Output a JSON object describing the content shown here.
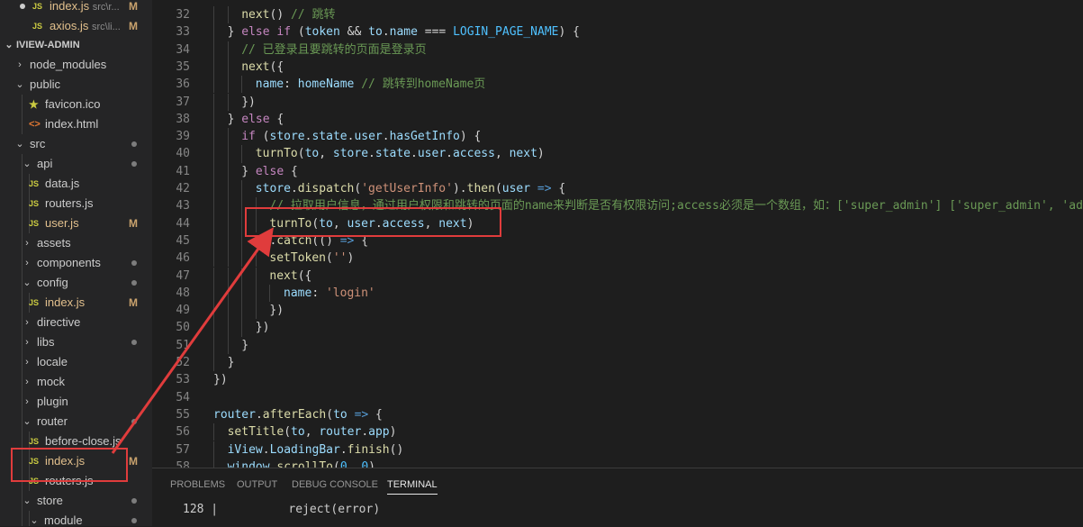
{
  "sidebar": {
    "open_editors": [
      {
        "name": "index.js",
        "sub": "src\\r...",
        "badge": "M"
      },
      {
        "name": "axios.js",
        "sub": "src\\li...",
        "badge": "M"
      }
    ],
    "project_title": "IVIEW-ADMIN",
    "tree": [
      {
        "name": "node_modules",
        "type": "folder",
        "open": false,
        "depth": 0
      },
      {
        "name": "public",
        "type": "folder",
        "open": true,
        "depth": 0
      },
      {
        "name": "favicon.ico",
        "type": "file",
        "icon": "star-icon",
        "depth": 1
      },
      {
        "name": "index.html",
        "type": "file",
        "icon": "html-icon",
        "depth": 1
      },
      {
        "name": "src",
        "type": "folder",
        "open": true,
        "depth": 0,
        "dot": true
      },
      {
        "name": "api",
        "type": "folder",
        "open": true,
        "depth": 1,
        "dot": true
      },
      {
        "name": "data.js",
        "type": "file",
        "icon": "js-icon",
        "depth": 2
      },
      {
        "name": "routers.js",
        "type": "file",
        "icon": "js-icon",
        "depth": 2
      },
      {
        "name": "user.js",
        "type": "file",
        "icon": "js-icon",
        "depth": 2,
        "badge": "M"
      },
      {
        "name": "assets",
        "type": "folder",
        "open": false,
        "depth": 1
      },
      {
        "name": "components",
        "type": "folder",
        "open": false,
        "depth": 1,
        "dot": true
      },
      {
        "name": "config",
        "type": "folder",
        "open": true,
        "depth": 1,
        "dot": true
      },
      {
        "name": "index.js",
        "type": "file",
        "icon": "js-icon",
        "depth": 2,
        "badge": "M"
      },
      {
        "name": "directive",
        "type": "folder",
        "open": false,
        "depth": 1
      },
      {
        "name": "libs",
        "type": "folder",
        "open": false,
        "depth": 1,
        "dot": true
      },
      {
        "name": "locale",
        "type": "folder",
        "open": false,
        "depth": 1
      },
      {
        "name": "mock",
        "type": "folder",
        "open": false,
        "depth": 1
      },
      {
        "name": "plugin",
        "type": "folder",
        "open": false,
        "depth": 1
      },
      {
        "name": "router",
        "type": "folder",
        "open": true,
        "depth": 1,
        "dot": true
      },
      {
        "name": "before-close.js",
        "type": "file",
        "icon": "js-icon",
        "depth": 2
      },
      {
        "name": "index.js",
        "type": "file",
        "icon": "js-icon",
        "depth": 2,
        "badge": "M"
      },
      {
        "name": "routers.js",
        "type": "file",
        "icon": "js-icon",
        "depth": 2
      },
      {
        "name": "store",
        "type": "folder",
        "open": true,
        "depth": 1,
        "dot": true
      },
      {
        "name": "module",
        "type": "folder",
        "open": true,
        "depth": 2,
        "dot": true
      }
    ]
  },
  "editor": {
    "lines": [
      {
        "n": "32",
        "indent": 4,
        "tokens": [
          [
            "fn",
            "next"
          ],
          [
            "pn",
            "() "
          ],
          [
            "cm",
            "// 跳转"
          ]
        ]
      },
      {
        "n": "33",
        "indent": 2,
        "tokens": [
          [
            "pn",
            "} "
          ],
          [
            "kw",
            "else if"
          ],
          [
            "pn",
            " ("
          ],
          [
            "var",
            "token"
          ],
          [
            "pn",
            " && "
          ],
          [
            "var",
            "to"
          ],
          [
            "pn",
            "."
          ],
          [
            "var",
            "name"
          ],
          [
            "pn",
            " === "
          ],
          [
            "cst",
            "LOGIN_PAGE_NAME"
          ],
          [
            "pn",
            ") {"
          ]
        ]
      },
      {
        "n": "34",
        "indent": 4,
        "tokens": [
          [
            "cm",
            "// 已登录且要跳转的页面是登录页"
          ]
        ]
      },
      {
        "n": "35",
        "indent": 4,
        "tokens": [
          [
            "fn",
            "next"
          ],
          [
            "pn",
            "({"
          ]
        ]
      },
      {
        "n": "36",
        "indent": 6,
        "tokens": [
          [
            "var",
            "name"
          ],
          [
            "pn",
            ": "
          ],
          [
            "var",
            "homeName"
          ],
          [
            "pn",
            " "
          ],
          [
            "cm",
            "// 跳转到homeName页"
          ]
        ]
      },
      {
        "n": "37",
        "indent": 4,
        "tokens": [
          [
            "pn",
            "})"
          ]
        ]
      },
      {
        "n": "38",
        "indent": 2,
        "tokens": [
          [
            "pn",
            "} "
          ],
          [
            "kw",
            "else"
          ],
          [
            "pn",
            " {"
          ]
        ]
      },
      {
        "n": "39",
        "indent": 4,
        "tokens": [
          [
            "kw",
            "if"
          ],
          [
            "pn",
            " ("
          ],
          [
            "var",
            "store"
          ],
          [
            "pn",
            "."
          ],
          [
            "var",
            "state"
          ],
          [
            "pn",
            "."
          ],
          [
            "var",
            "user"
          ],
          [
            "pn",
            "."
          ],
          [
            "var",
            "hasGetInfo"
          ],
          [
            "pn",
            ") {"
          ]
        ]
      },
      {
        "n": "40",
        "indent": 6,
        "tokens": [
          [
            "fn",
            "turnTo"
          ],
          [
            "pn",
            "("
          ],
          [
            "var",
            "to"
          ],
          [
            "pn",
            ", "
          ],
          [
            "var",
            "store"
          ],
          [
            "pn",
            "."
          ],
          [
            "var",
            "state"
          ],
          [
            "pn",
            "."
          ],
          [
            "var",
            "user"
          ],
          [
            "pn",
            "."
          ],
          [
            "var",
            "access"
          ],
          [
            "pn",
            ", "
          ],
          [
            "var",
            "next"
          ],
          [
            "pn",
            ")"
          ]
        ]
      },
      {
        "n": "41",
        "indent": 4,
        "tokens": [
          [
            "pn",
            "} "
          ],
          [
            "kw",
            "else"
          ],
          [
            "pn",
            " {"
          ]
        ]
      },
      {
        "n": "42",
        "indent": 6,
        "tokens": [
          [
            "var",
            "store"
          ],
          [
            "pn",
            "."
          ],
          [
            "fn",
            "dispatch"
          ],
          [
            "pn",
            "("
          ],
          [
            "str",
            "'getUserInfo'"
          ],
          [
            "pn",
            ")."
          ],
          [
            "fn",
            "then"
          ],
          [
            "pn",
            "("
          ],
          [
            "var",
            "user"
          ],
          [
            "pn",
            " "
          ],
          [
            "arr",
            "=>"
          ],
          [
            "pn",
            " {"
          ]
        ]
      },
      {
        "n": "43",
        "indent": 8,
        "tokens": [
          [
            "cm",
            "// 拉取用户信息，通过用户权限和跳转的页面的name来判断是否有权限访问;access必须是一个数组，如：['super_admin'] ['super_admin', 'admin']"
          ]
        ]
      },
      {
        "n": "44",
        "indent": 8,
        "tokens": [
          [
            "fn",
            "turnTo"
          ],
          [
            "pn",
            "("
          ],
          [
            "var",
            "to"
          ],
          [
            "pn",
            ", "
          ],
          [
            "var",
            "user"
          ],
          [
            "pn",
            "."
          ],
          [
            "var",
            "access"
          ],
          [
            "pn",
            ", "
          ],
          [
            "var",
            "next"
          ],
          [
            "pn",
            ")"
          ]
        ]
      },
      {
        "n": "45",
        "indent": 6,
        "tokens": [
          [
            "pn",
            "})."
          ],
          [
            "fn",
            "catch"
          ],
          [
            "pn",
            "(() "
          ],
          [
            "arr",
            "=>"
          ],
          [
            "pn",
            " {"
          ]
        ]
      },
      {
        "n": "46",
        "indent": 8,
        "tokens": [
          [
            "fn",
            "setToken"
          ],
          [
            "pn",
            "("
          ],
          [
            "str",
            "''"
          ],
          [
            "pn",
            ")"
          ]
        ]
      },
      {
        "n": "47",
        "indent": 8,
        "tokens": [
          [
            "fn",
            "next"
          ],
          [
            "pn",
            "({"
          ]
        ]
      },
      {
        "n": "48",
        "indent": 10,
        "tokens": [
          [
            "var",
            "name"
          ],
          [
            "pn",
            ": "
          ],
          [
            "str",
            "'login'"
          ]
        ]
      },
      {
        "n": "49",
        "indent": 8,
        "tokens": [
          [
            "pn",
            "})"
          ]
        ]
      },
      {
        "n": "50",
        "indent": 6,
        "tokens": [
          [
            "pn",
            "})"
          ]
        ]
      },
      {
        "n": "51",
        "indent": 4,
        "tokens": [
          [
            "pn",
            "}"
          ]
        ]
      },
      {
        "n": "52",
        "indent": 2,
        "tokens": [
          [
            "pn",
            "}"
          ]
        ]
      },
      {
        "n": "53",
        "indent": 0,
        "tokens": [
          [
            "pn",
            "})"
          ]
        ]
      },
      {
        "n": "54",
        "indent": 0,
        "tokens": []
      },
      {
        "n": "55",
        "indent": 0,
        "tokens": [
          [
            "var",
            "router"
          ],
          [
            "pn",
            "."
          ],
          [
            "fn",
            "afterEach"
          ],
          [
            "pn",
            "("
          ],
          [
            "var",
            "to"
          ],
          [
            "pn",
            " "
          ],
          [
            "arr",
            "=>"
          ],
          [
            "pn",
            " {"
          ]
        ]
      },
      {
        "n": "56",
        "indent": 2,
        "tokens": [
          [
            "fn",
            "setTitle"
          ],
          [
            "pn",
            "("
          ],
          [
            "var",
            "to"
          ],
          [
            "pn",
            ", "
          ],
          [
            "var",
            "router"
          ],
          [
            "pn",
            "."
          ],
          [
            "var",
            "app"
          ],
          [
            "pn",
            ")"
          ]
        ]
      },
      {
        "n": "57",
        "indent": 2,
        "tokens": [
          [
            "var",
            "iView"
          ],
          [
            "pn",
            "."
          ],
          [
            "var",
            "LoadingBar"
          ],
          [
            "pn",
            "."
          ],
          [
            "fn",
            "finish"
          ],
          [
            "pn",
            "()"
          ]
        ]
      },
      {
        "n": "58",
        "indent": 2,
        "tokens": [
          [
            "var",
            "window"
          ],
          [
            "pn",
            "."
          ],
          [
            "fn",
            "scrollTo"
          ],
          [
            "pn",
            "("
          ],
          [
            "cst",
            "0"
          ],
          [
            "pn",
            ", "
          ],
          [
            "cst",
            "0"
          ],
          [
            "pn",
            ")"
          ]
        ]
      }
    ]
  },
  "panel": {
    "tabs": [
      "PROBLEMS",
      "OUTPUT",
      "DEBUG CONSOLE",
      "TERMINAL"
    ],
    "active_tab": "TERMINAL",
    "terminal_line_number": "128",
    "terminal_text": "reject(error)"
  },
  "colors": {
    "highlight": "#e03c3c",
    "sidebar_bg": "#252526",
    "editor_bg": "#1e1e1e"
  }
}
